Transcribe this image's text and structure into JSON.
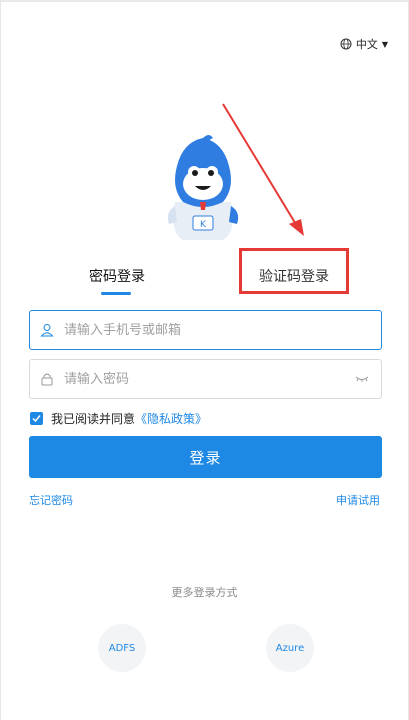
{
  "language": {
    "label": "中文"
  },
  "tabs": {
    "password_login": "密码登录",
    "sms_login": "验证码登录"
  },
  "form": {
    "account_placeholder": "请输入手机号或邮箱",
    "password_placeholder": "请输入密码",
    "agree_text": "我已阅读并同意",
    "privacy_link": "《隐私政策》",
    "login_button": "登录",
    "forgot_password": "忘记密码",
    "apply_trial": "申请试用"
  },
  "sso": {
    "heading": "更多登录方式",
    "adfs": "ADFS",
    "azure": "Azure"
  },
  "colors": {
    "accent": "#1e88e5",
    "annotation": "#e53935"
  }
}
